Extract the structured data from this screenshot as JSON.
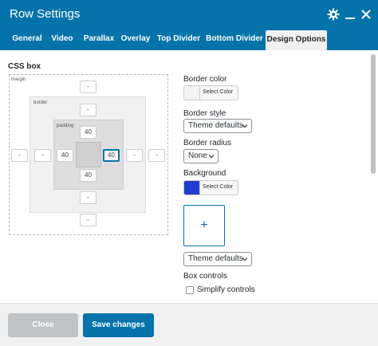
{
  "window": {
    "title": "Row Settings",
    "icons": [
      "gear-icon",
      "minimize-icon",
      "close-icon"
    ]
  },
  "tabs": [
    {
      "label": "General",
      "active": false
    },
    {
      "label": "Video",
      "active": false
    },
    {
      "label": "Parallax",
      "active": false
    },
    {
      "label": "Overlay",
      "active": false
    },
    {
      "label": "Top Divider",
      "active": false
    },
    {
      "label": "Bottom Divider",
      "active": false
    },
    {
      "label": "Design Options",
      "active": true
    }
  ],
  "css_box": {
    "title": "CSS box",
    "margin_label": "margin",
    "border_label": "border",
    "padding_label": "padding",
    "margin": {
      "top": "-",
      "right": "-",
      "bottom": "-",
      "left": "-"
    },
    "border": {
      "top": "-",
      "right": "-",
      "bottom": "-",
      "left": "-"
    },
    "padding": {
      "top": "40",
      "right": "40",
      "bottom": "40",
      "left": "40"
    }
  },
  "options": {
    "border_color": {
      "label": "Border color",
      "button": "Select Color",
      "value": "#f1f3f5"
    },
    "border_style": {
      "label": "Border style",
      "value": "Theme defaults"
    },
    "border_radius": {
      "label": "Border radius",
      "value": "None"
    },
    "background": {
      "label": "Background",
      "button": "Select Color",
      "value": "#1f3ed1"
    },
    "add_image": "+",
    "background_style": {
      "value": "Theme defaults"
    },
    "box_controls": {
      "label": "Box controls",
      "checkbox_label": "Simplify controls",
      "checked": false
    }
  },
  "footer": {
    "close_label": "Close",
    "save_label": "Save changes"
  },
  "colors": {
    "accent": "#0473aa",
    "disabled": "#bfc3c6"
  }
}
